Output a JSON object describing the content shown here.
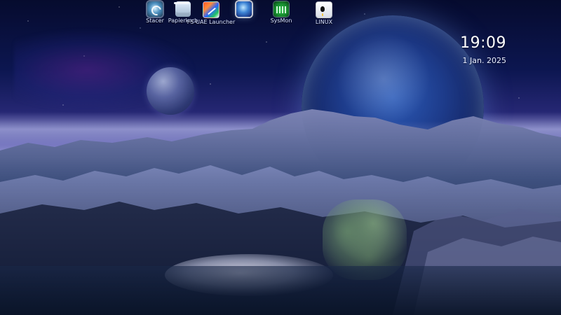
{
  "desktop": {
    "icons": [
      {
        "label": "Stacer",
        "icon": "stacer-icon"
      },
      {
        "label": "Papierkorb",
        "icon": "trash-icon"
      },
      {
        "label": "FS-UAE Launcher",
        "icon": "fs-uae-launcher-icon"
      },
      {
        "label": "",
        "icon": "globe-icon"
      },
      {
        "label": "SysMon",
        "icon": "sysmon-icon"
      },
      {
        "label": "LINUX",
        "icon": "document-icon"
      }
    ]
  },
  "clock": {
    "time": "19:09",
    "date": "1 Jan. 2025"
  }
}
